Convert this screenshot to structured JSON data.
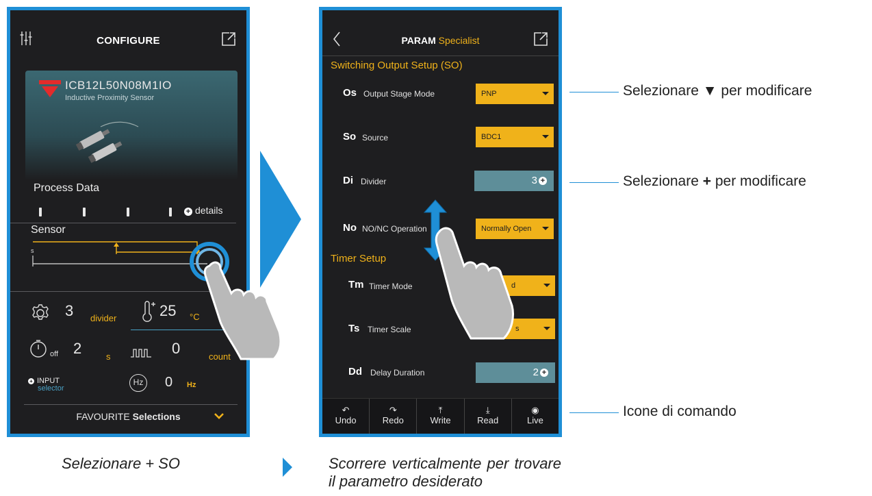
{
  "phone1": {
    "title": "CONFIGURE",
    "device": {
      "model": "ICB12L50N08M1IO",
      "type": "Inductive Proximity Sensor"
    },
    "process_title": "Process Data",
    "process_levels": [
      0.2,
      0.4,
      0.55,
      0.75
    ],
    "details_label": "details",
    "sensor_title": "Sensor",
    "sensor_axis_label": "s",
    "divider_value": "3",
    "divider_label": "divider",
    "temperature_value": "25",
    "temperature_unit": "°C",
    "timer_value": "2",
    "timer_sub": "off",
    "timer_unit": "s",
    "count_value": "0",
    "count_label": "count",
    "input_label": "INPUT",
    "input_sub": "selector",
    "hz_icon_label": "Hz",
    "hz_value": "0",
    "hz_unit": "Hz",
    "favourite_prefix": "FAVOURITE",
    "favourite_bold": "Selections"
  },
  "phone2": {
    "title_bold": "PARAM",
    "title_accent": "Specialist",
    "section_so": "Switching Output Setup (SO)",
    "section_timer": "Timer Setup",
    "params": {
      "os": {
        "code": "Os",
        "desc": "Output Stage Mode",
        "value": "PNP"
      },
      "so": {
        "code": "So",
        "desc": "Source",
        "value": "BDC1"
      },
      "di": {
        "code": "Di",
        "desc": "Divider",
        "value": "3"
      },
      "no": {
        "code": "No",
        "desc": "NO/NC Operation",
        "value": "Normally Open"
      },
      "tm": {
        "code": "Tm",
        "desc": "Timer Mode",
        "value": "d"
      },
      "ts": {
        "code": "Ts",
        "desc": "Timer Scale",
        "value": "s"
      },
      "dd": {
        "code": "Dd",
        "desc": "Delay Duration",
        "value": "2"
      }
    },
    "commands": [
      "Undo",
      "Redo",
      "Write",
      "Read",
      "Live"
    ]
  },
  "annotations": {
    "select_prefix": "Selezionare",
    "select_glyph_down": "▼",
    "select_glyph_plus": "+",
    "select_suffix": "per modificare",
    "command_icons": "Icone di comando"
  },
  "captions": {
    "left": "Selezionare + SO",
    "right": "Scorrere verticalmente per trovare il parametro desiderato"
  },
  "colors": {
    "frame": "#1f8fd6",
    "accent": "#f0b21a",
    "screen": "#1e1e20",
    "numeric": "#5e8e99",
    "brand_red": "#e32b2b"
  }
}
